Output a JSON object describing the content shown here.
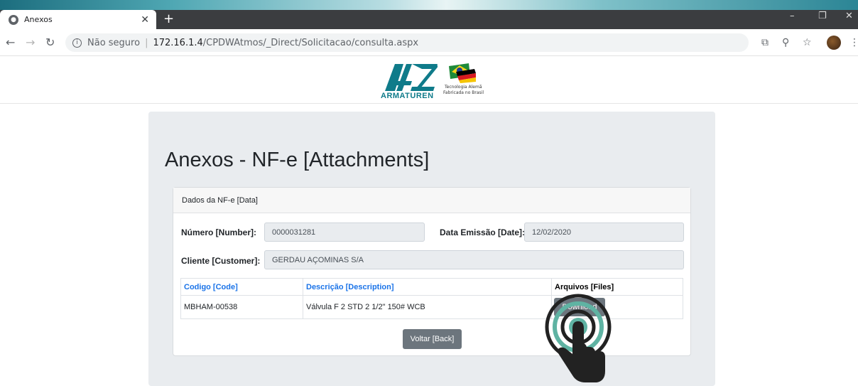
{
  "browser": {
    "tab_title": "Anexos",
    "url_label": "Não seguro",
    "url_host": "172.16.1.4",
    "url_path": "/CPDWAtmos/_Direct/Solicitacao/consulta.aspx"
  },
  "logo": {
    "brand": "ARMATUREN",
    "tagline_1": "Tecnologia Alemã",
    "tagline_2": "Fabricada no Brasil"
  },
  "page": {
    "heading": "Anexos - NF-e [Attachments]",
    "card_title": "Dados da NF-e [Data]"
  },
  "form": {
    "number_label": "Número [Number]:",
    "number_value": "0000031281",
    "date_label": "Data Emissão [Date]:",
    "date_value": "12/02/2020",
    "customer_label": "Cliente [Customer]:",
    "customer_value": "GERDAU AÇOMINAS S/A"
  },
  "table": {
    "headers": [
      "Codigo [Code]",
      "Descrição [Description]",
      "Arquivos [Files]"
    ],
    "rows": [
      {
        "code": "MBHAM-00538",
        "description": "Válvula F 2 STD 2 1/2\" 150# WCB",
        "file_button": "Download"
      }
    ]
  },
  "buttons": {
    "back": "Voltar [Back]"
  },
  "colors": {
    "brand_teal": "#0f7b8a",
    "button_gray": "#6c757d",
    "link_blue": "#1a73e8",
    "tap_ring": "#5fb3a3"
  },
  "icons": [
    "globe-icon",
    "close-icon",
    "plus-icon",
    "back-arrow-icon",
    "forward-arrow-icon",
    "reload-icon",
    "info-icon",
    "translate-icon",
    "zoom-icon",
    "star-icon",
    "menu-icon",
    "tap-gesture-icon"
  ]
}
